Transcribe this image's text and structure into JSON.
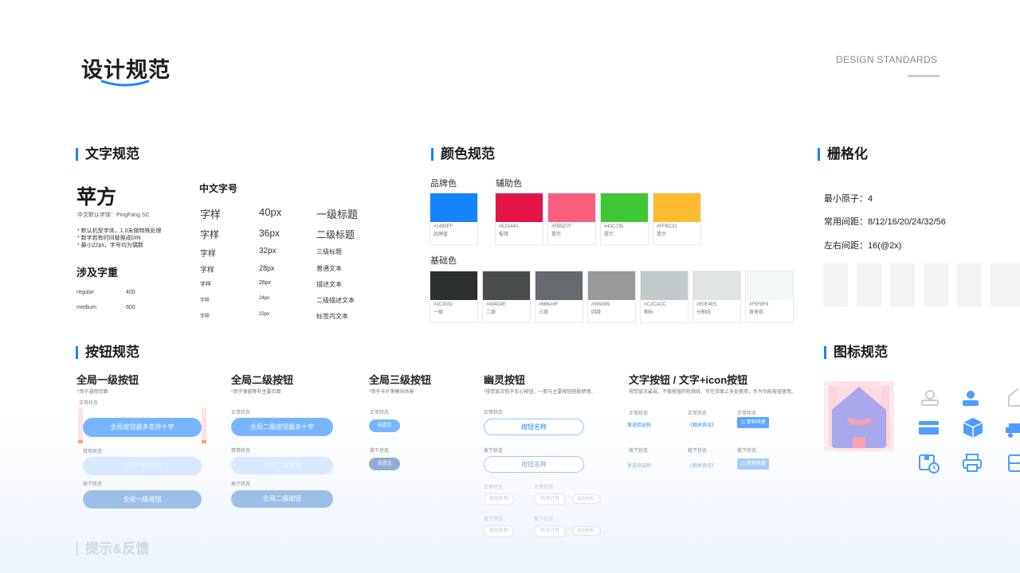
{
  "header": {
    "title": "设计规范",
    "brand_en": "DESIGN STANDARDS"
  },
  "text_spec": {
    "heading": "文字规范",
    "font_name": "苹方",
    "font_default": "中文默认字体：PingFang SC",
    "notes": [
      "* 默认机型字体，1.0未做特殊处理",
      "* 数字若有时间替换成DIN",
      "* 最小22px，字号均为偶数"
    ],
    "weights_title": "涉及字重",
    "weights": [
      {
        "name": "regular",
        "value": "400"
      },
      {
        "name": "medium",
        "value": "600"
      }
    ],
    "sizes_title": "中文字号",
    "sizes": [
      {
        "sample": "字样",
        "px": "40px",
        "usage": "一级标题"
      },
      {
        "sample": "字样",
        "px": "36px",
        "usage": "二级标题"
      },
      {
        "sample": "字样",
        "px": "32px",
        "usage": "三级标题"
      },
      {
        "sample": "字样",
        "px": "28px",
        "usage": "普通文本"
      },
      {
        "sample": "字样",
        "px": "26px",
        "usage": "描述文本"
      },
      {
        "sample": "字样",
        "px": "24px",
        "usage": "二级描述文本"
      },
      {
        "sample": "字样",
        "px": "22px",
        "usage": "标签内文本"
      }
    ]
  },
  "color_spec": {
    "heading": "颜色规范",
    "brand_label": "品牌色",
    "aux_label": "辅助色",
    "base_label": "基础色",
    "brand": [
      {
        "hex": "#1485FF",
        "name": "品牌蓝"
      }
    ],
    "aux": [
      {
        "hex": "#E2144A",
        "name": "报错"
      },
      {
        "hex": "#FB5D7F",
        "name": "提示"
      },
      {
        "hex": "#40C735",
        "name": "提示"
      },
      {
        "hex": "#FFBC31",
        "name": "提示"
      }
    ],
    "base": [
      {
        "hex": "#2C3031",
        "name": "一级"
      },
      {
        "hex": "#494D4E",
        "name": "二级"
      },
      {
        "hex": "#666A6F",
        "name": "三级"
      },
      {
        "hex": "#999999",
        "name": "四级"
      },
      {
        "hex": "#C2CACC",
        "name": "图标"
      },
      {
        "hex": "#E0E4E5",
        "name": "分割线"
      },
      {
        "hex": "#F5F8F8",
        "name": "背景色"
      }
    ]
  },
  "grid_spec": {
    "heading": "栅格化",
    "min_atom": "最小原子：4",
    "spacing": "常用间距：8/12/16/20/24/32/56",
    "lr_spacing": "左右间距：16(@2x)"
  },
  "button_spec": {
    "heading": "按钮规范",
    "primary": {
      "title": "全局一级按钮",
      "sub": "*用于通用页面",
      "normal_state": "正常状态",
      "normal_label": "全局按钮最多支持十字",
      "disabled_state": "禁用状态",
      "disabled_label": "全局一级按钮",
      "pressed_state": "按下状态",
      "pressed_label": "全局一级按钮"
    },
    "secondary": {
      "title": "全局二级按钮",
      "sub": "*用于弹窗等非主要页面",
      "normal_state": "正常状态",
      "normal_label": "全局二级按钮最多十字",
      "disabled_state": "禁用状态",
      "disabled_label": "全局二级按钮",
      "pressed_state": "按下状态",
      "pressed_label": "全局二级按钮"
    },
    "tertiary": {
      "title": "全局三级按钮",
      "sub": "*用于卡片等模块场景",
      "normal_state": "正常状态",
      "normal_label": "去提交",
      "pressed_state": "按下状态",
      "pressed_label": "去提交"
    },
    "ghost": {
      "title": "幽灵按钮",
      "sub": "*视觉层次低于实心按钮，一般与主要按钮搭配使用。",
      "normal_state": "正常状态",
      "normal_label": "按钮名称",
      "pressed_state": "按下状态",
      "pressed_label": "按钮名称",
      "small_state_a": "正常状态",
      "small_state_b": "正常状态",
      "small_a": "按钮名称",
      "small_b": "取消订单",
      "small_c": "退货规则 ›",
      "small_state_c": "按下状态",
      "small_state_d": "按下状态",
      "small_d": "按钮名称",
      "small_e": "取消订单",
      "small_f": "退货规则 ›"
    },
    "text_btn": {
      "title": "文字按钮 / 文字+icon按钮",
      "sub": "视觉层次最弱，不做按钮的轮廓线，可在页面上多处使用，作为功能按钮使用。",
      "state_1": "正常状态",
      "state_2": "正常状态",
      "state_3": "正常状态",
      "link_1": "发送验证码",
      "link_2": "《相关协议》",
      "btn_1": "◫ 复制快递",
      "pstate_1": "按下状态",
      "pstate_2": "按下状态",
      "pstate_3": "按下状态",
      "plink_1": "发送验证码",
      "plink_2": "《相关协议》",
      "pbtn_1": "◫ 复制快递"
    }
  },
  "icon_spec": {
    "heading": "图标规范"
  },
  "feedback_spec": {
    "heading": "提示&反馈"
  },
  "colors": {
    "accent": "#1485FF"
  }
}
